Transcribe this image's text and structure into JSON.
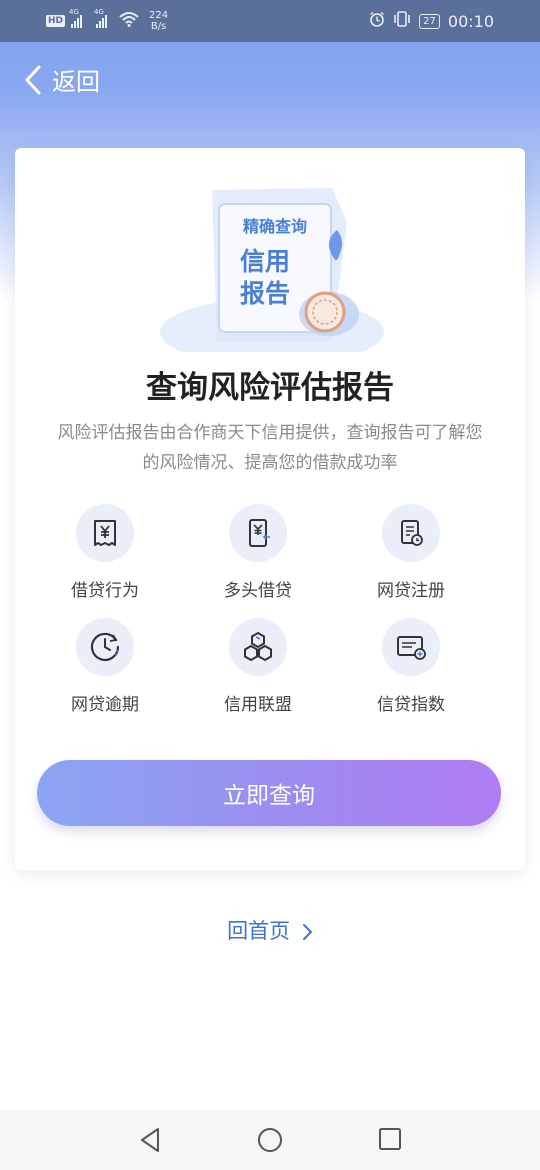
{
  "status_bar": {
    "network_1": "4G",
    "network_2": "4G",
    "speed_value": "224",
    "speed_unit": "B/s",
    "battery": "27",
    "time": "00:10",
    "icons": [
      "hd-icon",
      "signal-icon",
      "signal-icon",
      "wifi-icon",
      "alarm-icon",
      "vibrate-icon",
      "battery-icon"
    ]
  },
  "nav": {
    "back_label": "返回"
  },
  "card": {
    "illustration": {
      "top_text": "精确查询",
      "main_line_1": "信用",
      "main_line_2": "报告"
    },
    "title": "查询风险评估报告",
    "description": "风险评估报告由合作商天下信用提供，查询报告可了解您的风险情况、提高您的借款成功率",
    "features": [
      {
        "label": "借贷行为",
        "icon": "receipt-yuan-icon"
      },
      {
        "label": "多头借贷",
        "icon": "phone-yuan-icon"
      },
      {
        "label": "网贷注册",
        "icon": "document-clock-icon"
      },
      {
        "label": "网贷逾期",
        "icon": "clock-icon"
      },
      {
        "label": "信用联盟",
        "icon": "hexagon-cluster-icon"
      },
      {
        "label": "信贷指数",
        "icon": "card-plus-icon"
      }
    ],
    "cta_label": "立即查询"
  },
  "home_link": {
    "label": "回首页",
    "icon": "chevron-right-icon"
  },
  "system_nav": {
    "icons": [
      "back-triangle-icon",
      "home-circle-icon",
      "recents-square-icon"
    ]
  },
  "colors": {
    "accent": "#3d74c9",
    "header": "#5b6f9b",
    "gradient_start": "#8aa6f3",
    "gradient_end": "#b07cf3"
  }
}
